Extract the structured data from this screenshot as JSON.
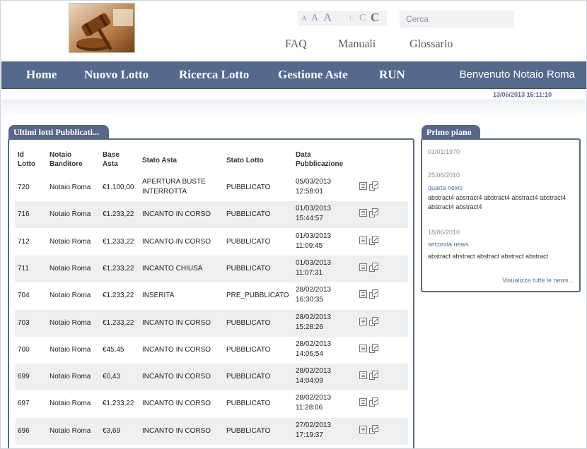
{
  "header": {
    "font_sizes": [
      "A",
      "A",
      "A"
    ],
    "contrast": [
      "C",
      "C",
      "C"
    ],
    "search_placeholder": "Cerca",
    "links": [
      "FAQ",
      "Manuali",
      "Glossario"
    ]
  },
  "nav": {
    "items": [
      "Home",
      "Nuovo Lotto",
      "Ricerca Lotto",
      "Gestione Aste",
      "RUN"
    ],
    "welcome": "Benvenuto Notaio Roma",
    "datetime": "13/06/2013 16:11:10"
  },
  "lots": {
    "tab": "Ultimi lotti Pubblicati...",
    "headers": {
      "id": [
        "Id",
        "Lotto"
      ],
      "notaio": [
        "Notaio",
        "Banditore"
      ],
      "base": [
        "Base",
        "Asta"
      ],
      "stato_asta": "Stato Asta",
      "stato_lotto": "Stato Lotto",
      "data": [
        "Data",
        "Pubblicazione"
      ]
    },
    "rows": [
      {
        "id": "720",
        "notaio": "Notaio Roma",
        "base": "€1.100,00",
        "stato_asta": [
          "APERTURA BUSTE",
          "INTERROTTA"
        ],
        "stato_lotto": "PUBBLICATO",
        "date": "05/03/2013",
        "time": "12:58:01"
      },
      {
        "id": "716",
        "notaio": "Notaio Roma",
        "base": "€1.233,22",
        "stato_asta": [
          "INCANTO IN CORSO"
        ],
        "stato_lotto": "PUBBLICATO",
        "date": "01/03/2013",
        "time": "15:44:57"
      },
      {
        "id": "712",
        "notaio": "Notaio Roma",
        "base": "€1.233,22",
        "stato_asta": [
          "INCANTO IN CORSO"
        ],
        "stato_lotto": "PUBBLICATO",
        "date": "01/03/2013",
        "time": "11:09:45"
      },
      {
        "id": "711",
        "notaio": "Notaio Roma",
        "base": "€1.233,22",
        "stato_asta": [
          "INCANTO CHIUSA"
        ],
        "stato_lotto": "PUBBLICATO",
        "date": "01/03/2013",
        "time": "11:07:31"
      },
      {
        "id": "704",
        "notaio": "Notaio Roma",
        "base": "€1.233,22",
        "stato_asta": [
          "INSERITA"
        ],
        "stato_lotto": "PRE_PUBBLICATO",
        "date": "28/02/2013",
        "time": "16:30:35"
      },
      {
        "id": "703",
        "notaio": "Notaio Roma",
        "base": "€1.233,22",
        "stato_asta": [
          "INCANTO IN CORSO"
        ],
        "stato_lotto": "PUBBLICATO",
        "date": "28/02/2013",
        "time": "15:28:26"
      },
      {
        "id": "700",
        "notaio": "Notaio Roma",
        "base": "€45,45",
        "stato_asta": [
          "INCANTO IN CORSO"
        ],
        "stato_lotto": "PUBBLICATO",
        "date": "28/02/2013",
        "time": "14:06:54"
      },
      {
        "id": "699",
        "notaio": "Notaio Roma",
        "base": "€0,43",
        "stato_asta": [
          "INCANTO IN CORSO"
        ],
        "stato_lotto": "PUBBLICATO",
        "date": "28/02/2013",
        "time": "14:04:09"
      },
      {
        "id": "697",
        "notaio": "Notaio Roma",
        "base": "€1.233,22",
        "stato_asta": [
          "INCANTO IN CORSO"
        ],
        "stato_lotto": "PUBBLICATO",
        "date": "28/02/2013",
        "time": "11:28:06"
      },
      {
        "id": "696",
        "notaio": "Notaio Roma",
        "base": "€3,69",
        "stato_asta": [
          "INCANTO IN CORSO"
        ],
        "stato_lotto": "PUBBLICATO",
        "date": "27/02/2013",
        "time": "17:19:37"
      }
    ]
  },
  "news": {
    "tab": "Primo piano",
    "items": [
      {
        "date": "01/01/1970",
        "title": "",
        "abstract": ""
      },
      {
        "date": "25/06/2010",
        "title": "quarta news",
        "abstract": "abstract4 abstract4 abstract4 abstract4 abstract4 abstract4 abstract4"
      },
      {
        "date": "18/06/2010",
        "title": "seconda news",
        "abstract": "abstract abstract abstract abstract abstract"
      }
    ],
    "view_all": "Visualizza tutte le news..."
  }
}
